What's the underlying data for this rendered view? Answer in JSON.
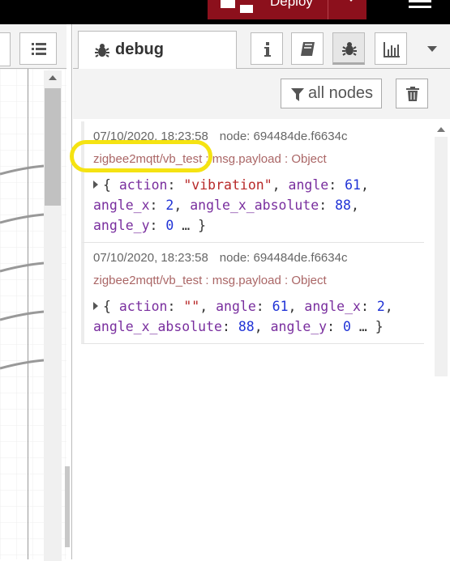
{
  "header": {
    "deploy_label": "Deploy"
  },
  "sidebar": {
    "active_tab": "debug",
    "tab_buttons": [
      "info-icon",
      "book-icon",
      "bug-icon",
      "chart-icon"
    ],
    "filter": {
      "label": "all nodes"
    },
    "messages": [
      {
        "timestamp": "07/10/2020, 18:23:58",
        "node": "node: 694484de.f6634c",
        "topic": "zigbee2mqtt/vb_test",
        "separator": " : ",
        "msg_type": "msg.payload : Object",
        "payload": {
          "open": "{ ",
          "action_key": "action",
          "action_val": "\"vibration\"",
          "c1": ", ",
          "angle_key": "angle",
          "angle_val": "61",
          "c2": ", ",
          "angle_x_key": "angle_x",
          "angle_x_val": "2",
          "c3": ", ",
          "angle_x_abs_key": "angle_x_absolute",
          "angle_x_abs_val": "88",
          "c4": ", ",
          "angle_y_key": "angle_y",
          "angle_y_val": "0",
          "close": " … }"
        },
        "highlighted": true
      },
      {
        "timestamp": "07/10/2020, 18:23:58",
        "node": "node: 694484de.f6634c",
        "topic": "zigbee2mqtt/vb_test",
        "separator": " : ",
        "msg_type": "msg.payload : Object",
        "payload": {
          "open": "{ ",
          "action_key": "action",
          "action_val": "\"\"",
          "c1": ", ",
          "angle_key": "angle",
          "angle_val": "61",
          "c2": ", ",
          "angle_x_key": "angle_x",
          "angle_x_val": "2",
          "c3": ", ",
          "angle_x_abs_key": "angle_x_absolute",
          "angle_x_abs_val": "88",
          "c4": ", ",
          "angle_y_key": "angle_y",
          "angle_y_val": "0",
          "close": " … }"
        },
        "highlighted": false
      }
    ]
  },
  "colors": {
    "deploy_bg": "#8c101c",
    "highlight": "#f5e312",
    "topic": "#a66666",
    "key": "#792e9e",
    "string": "#b72828",
    "number": "#2033d6"
  }
}
